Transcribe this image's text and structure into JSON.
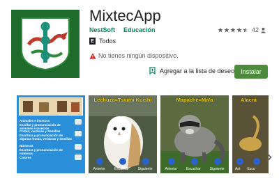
{
  "app": {
    "title": "MixtecApp",
    "developer": "NestSoft",
    "category": "Educación",
    "rating_count": "42",
    "stars": 4.5,
    "content_rating_label": "Todos",
    "content_rating_badge": "E",
    "device_warning": "No tienes ningún dispositivo.",
    "wishlist_label": "Agregar a la lista de deseos",
    "install_label": "Instalar"
  },
  "colors": {
    "accent_green": "#01875f",
    "install_bg": "#4c8a3c",
    "icon_bg": "#1f6b2c"
  },
  "screenshots": [
    {
      "menu": [
        "Animales e insectos",
        "Escribe y pronunciación de animales e insectos",
        "Frutas, verduras y Semillas",
        "Escritura y pronunciación de algunas frutas, verduras y semillas",
        "Números",
        "Escritura y pronunciación de números",
        "Colores"
      ]
    },
    {
      "title": "Lechuza=Tsiumi Kuishi",
      "buttons": [
        "Anterior",
        "Escuchar",
        "Siguiente"
      ]
    },
    {
      "title": "Mapache=Ma'a",
      "buttons": [
        "Anterior",
        "Escuchar",
        "Siguiente"
      ]
    },
    {
      "title": "Alacrá",
      "buttons": [
        "Ant",
        "Escu"
      ]
    }
  ],
  "icons": {
    "wishlist": "bookmark-add-icon",
    "warning": "warning-icon",
    "next": "chevron-right-icon"
  }
}
